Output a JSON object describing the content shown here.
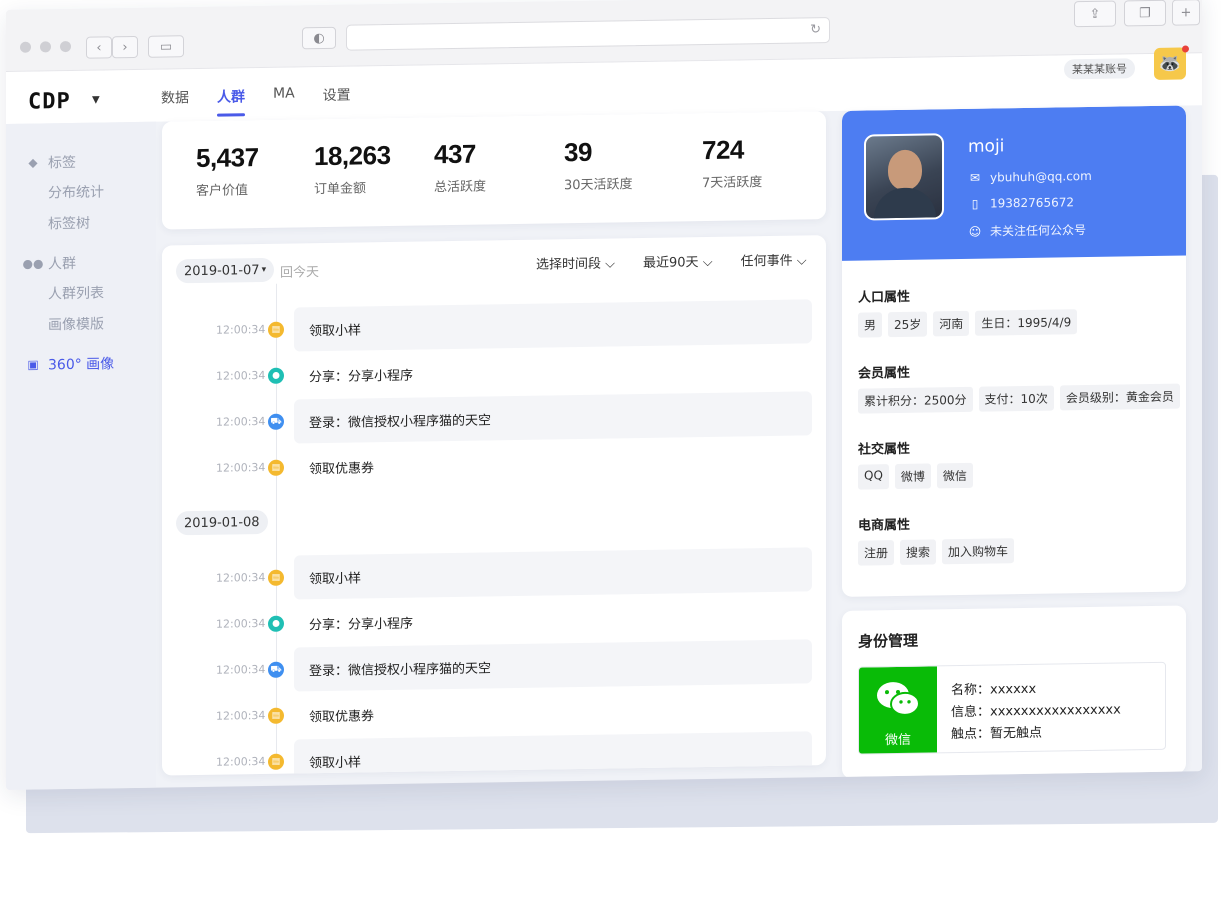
{
  "window": {
    "account": "某某某账号"
  },
  "app": {
    "logo": "CDP",
    "nav": [
      "数据",
      "人群",
      "MA",
      "设置"
    ],
    "active_nav": "人群"
  },
  "sidebar": {
    "groups": [
      {
        "label": "标签",
        "icon": "tag-icon",
        "items": [
          "分布统计",
          "标签树"
        ]
      },
      {
        "label": "人群",
        "icon": "people-icon",
        "items": [
          "人群列表",
          "画像模版"
        ]
      },
      {
        "label": "360° 画像",
        "icon": "portrait-icon",
        "items": [],
        "active": true
      }
    ]
  },
  "stats": [
    {
      "value": "5,437",
      "label": "客户价值"
    },
    {
      "value": "18,263",
      "label": "订单金额"
    },
    {
      "value": "437",
      "label": "总活跃度"
    },
    {
      "value": "39",
      "label": "30天活跃度"
    },
    {
      "value": "724",
      "label": "7天活跃度"
    }
  ],
  "timeline": {
    "date_picker": "2019-01-07",
    "back_today": "回今天",
    "filter_period_placeholder": "选择时间段",
    "filter_range": "最近90天",
    "filter_event": "任何事件",
    "days": [
      {
        "date": "2019-01-07",
        "events": [
          {
            "time": "12:00:34",
            "icon": "coupon-icon",
            "color": "#f4b92f",
            "text": "领取小样"
          },
          {
            "time": "12:00:34",
            "icon": "share-user-icon",
            "color": "#1fbfb4",
            "text": "分享：分享小程序"
          },
          {
            "time": "12:00:34",
            "icon": "cart-icon",
            "color": "#3f8ff0",
            "text": "登录：微信授权小程序猫的天空"
          },
          {
            "time": "12:00:34",
            "icon": "coupon-icon",
            "color": "#f4b92f",
            "text": "领取优惠券"
          }
        ]
      },
      {
        "date": "2019-01-08",
        "events": [
          {
            "time": "12:00:34",
            "icon": "coupon-icon",
            "color": "#f4b92f",
            "text": "领取小样"
          },
          {
            "time": "12:00:34",
            "icon": "share-user-icon",
            "color": "#1fbfb4",
            "text": "分享：分享小程序"
          },
          {
            "time": "12:00:34",
            "icon": "cart-icon",
            "color": "#3f8ff0",
            "text": "登录：微信授权小程序猫的天空"
          },
          {
            "time": "12:00:34",
            "icon": "coupon-icon",
            "color": "#f4b92f",
            "text": "领取优惠券"
          },
          {
            "time": "12:00:34",
            "icon": "coupon-icon",
            "color": "#f4b92f",
            "text": "领取小样"
          }
        ]
      }
    ]
  },
  "profile": {
    "name": "moji",
    "email": "ybuhuh@qq.com",
    "phone": "19382765672",
    "wechat_status": "未关注任何公众号",
    "header_color": "#4d7df2",
    "sections": [
      {
        "title": "人口属性",
        "tags": [
          "男",
          "25岁",
          "河南",
          "生日：1995/4/9"
        ]
      },
      {
        "title": "会员属性",
        "tags": [
          "累计积分：2500分",
          "支付：10次",
          "会员级别：黄金会员"
        ]
      },
      {
        "title": "社交属性",
        "tags": [
          "QQ",
          "微博",
          "微信"
        ]
      },
      {
        "title": "电商属性",
        "tags": [
          "注册",
          "搜索",
          "加入购物车"
        ]
      }
    ]
  },
  "identity": {
    "title": "身份管理",
    "channel": "微信",
    "channel_color": "#09bb07",
    "name_line": "名称：xxxxxx",
    "info_line": "信息：xxxxxxxxxxxxxxxxxx",
    "touch_line": "触点：暂无触点"
  }
}
